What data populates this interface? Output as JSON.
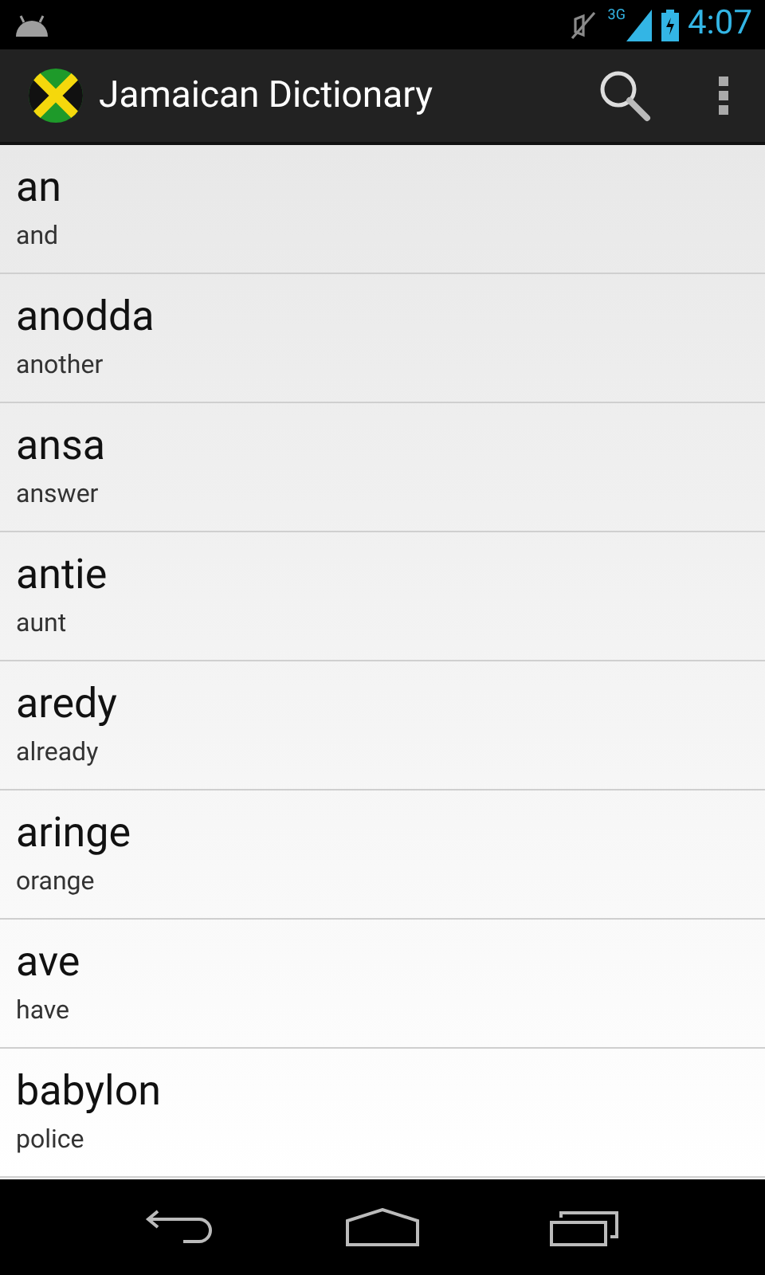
{
  "status_bar": {
    "network": "3G",
    "time": "4:07"
  },
  "action_bar": {
    "title": "Jamaican Dictionary"
  },
  "entries": [
    {
      "word": "an",
      "meaning": "and"
    },
    {
      "word": "anodda",
      "meaning": "another"
    },
    {
      "word": "ansa",
      "meaning": "answer"
    },
    {
      "word": "antie",
      "meaning": "aunt"
    },
    {
      "word": "aredy",
      "meaning": "already"
    },
    {
      "word": "aringe",
      "meaning": "orange"
    },
    {
      "word": "ave",
      "meaning": "have"
    },
    {
      "word": "babylon",
      "meaning": "police"
    }
  ]
}
